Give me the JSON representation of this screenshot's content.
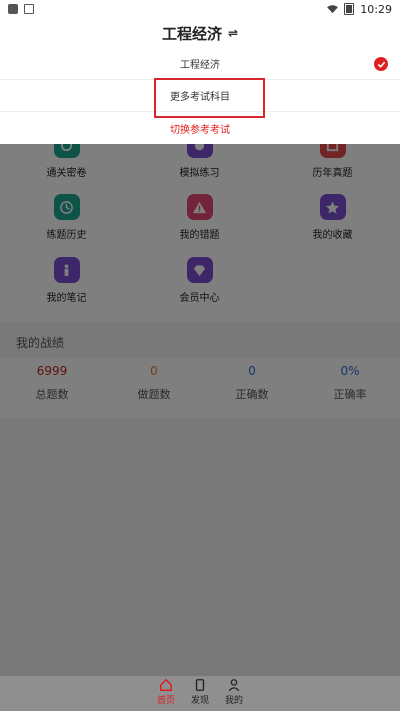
{
  "status_bar": {
    "time": "10:29"
  },
  "header": {
    "title": "工程经济",
    "swap_icon": "⇌"
  },
  "dropdown": {
    "current_subject": "工程经济",
    "more_subjects": "更多考试科目",
    "switch_exam": "切换参考考试"
  },
  "grid": {
    "row1": [
      "通关密卷",
      "模拟练习",
      "历年真题"
    ],
    "row2": [
      "练题历史",
      "我的错题",
      "我的收藏"
    ],
    "row3": [
      "我的笔记",
      "会员中心"
    ]
  },
  "colors": {
    "teal": "#1aa68e",
    "pink": "#e54b75",
    "purple": "#7a4fd1",
    "orange": "#e07b39",
    "accent": "#e02020"
  },
  "stats": {
    "title": "我的战绩",
    "items": [
      {
        "value": "6999",
        "label": "总题数"
      },
      {
        "value": "0",
        "label": "做题数"
      },
      {
        "value": "0",
        "label": "正确数"
      },
      {
        "value": "0%",
        "label": "正确率"
      }
    ]
  },
  "tabbar": {
    "tabs": [
      {
        "label": "首页",
        "icon": "home-icon"
      },
      {
        "label": "发现",
        "icon": "discover-icon"
      },
      {
        "label": "我的",
        "icon": "user-icon"
      }
    ]
  }
}
